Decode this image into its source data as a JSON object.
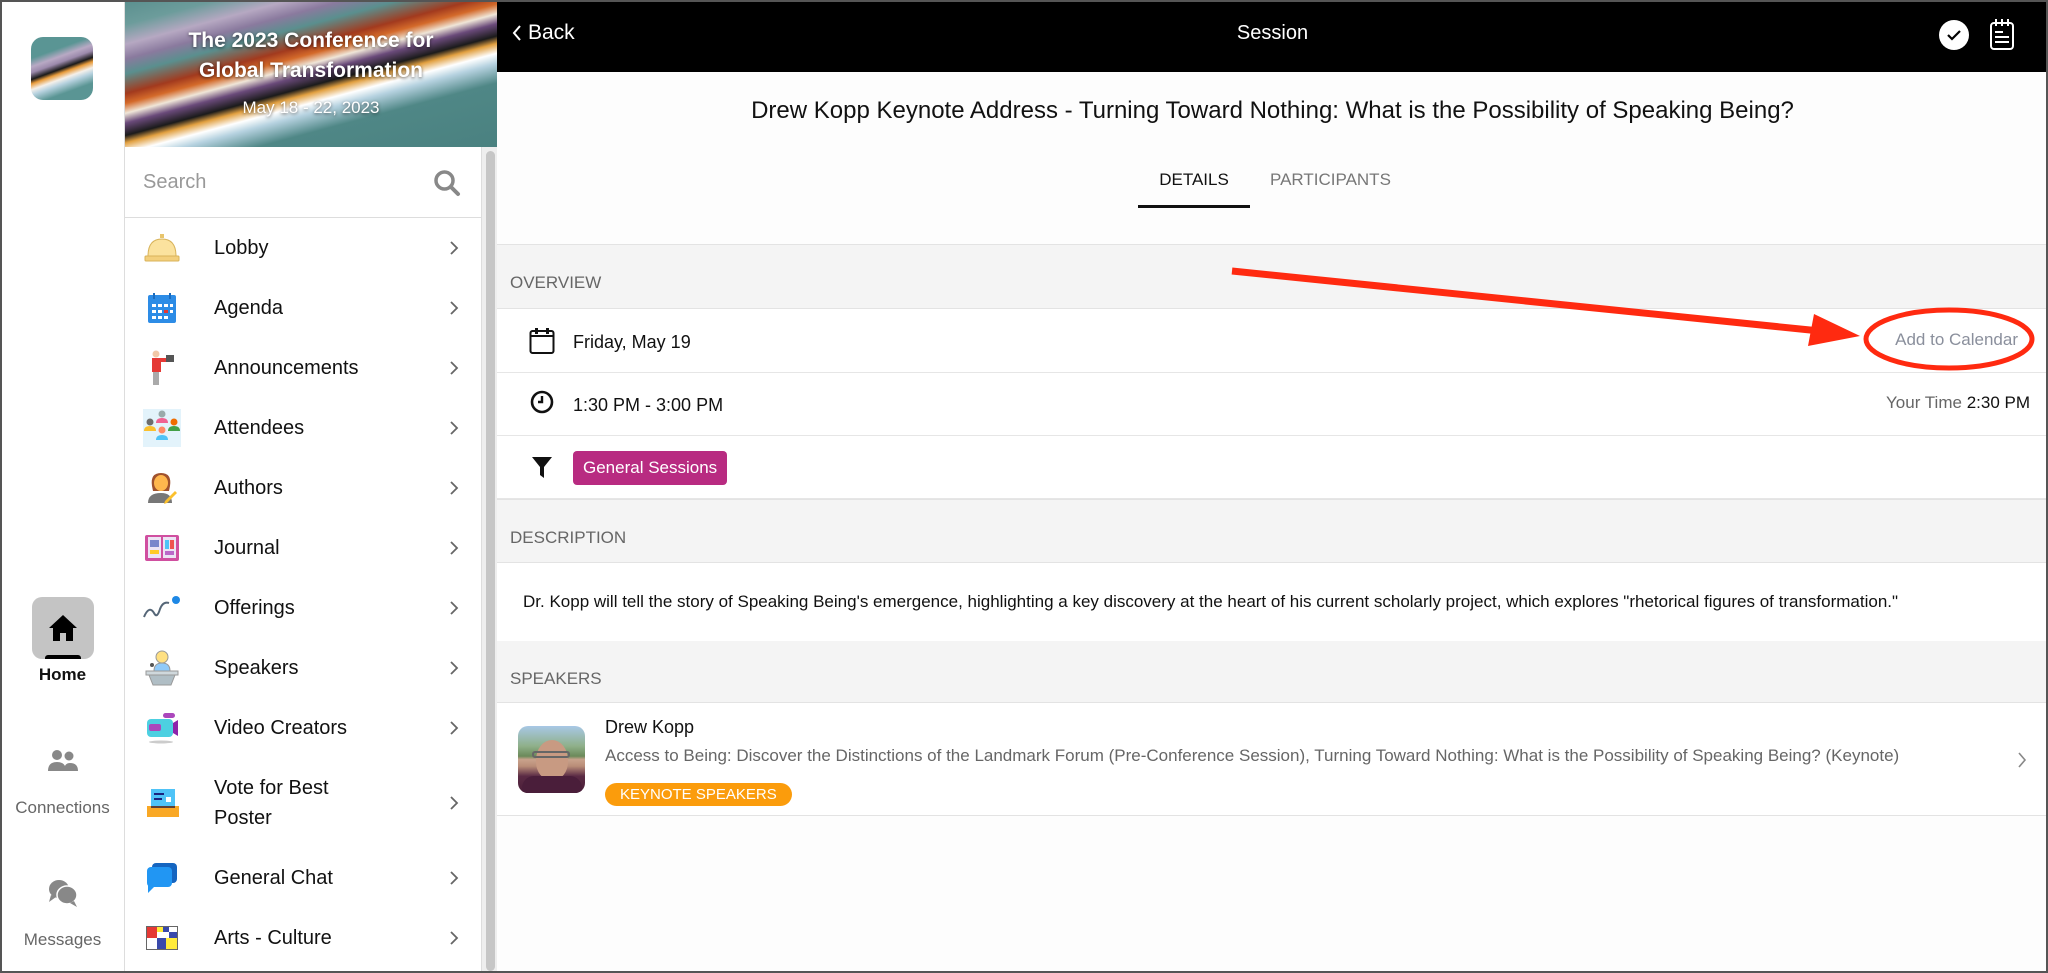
{
  "rail": {
    "items": [
      {
        "label": "Home",
        "icon": "home-icon",
        "active": true
      },
      {
        "label": "Connections",
        "icon": "people-icon",
        "active": false
      },
      {
        "label": "Messages",
        "icon": "chat-bubbles-icon",
        "active": false
      }
    ]
  },
  "sidebar": {
    "banner_title_line1": "The 2023 Conference for",
    "banner_title_line2": "Global Transformation",
    "banner_date": "May 18 - 22, 2023",
    "search_placeholder": "Search",
    "items": [
      {
        "label": "Lobby",
        "icon": "service-bell-icon"
      },
      {
        "label": "Agenda",
        "icon": "calendar-icon"
      },
      {
        "label": "Announcements",
        "icon": "megaphone-person-icon"
      },
      {
        "label": "Attendees",
        "icon": "group-icon"
      },
      {
        "label": "Authors",
        "icon": "author-icon"
      },
      {
        "label": "Journal",
        "icon": "open-book-icon"
      },
      {
        "label": "Offerings",
        "icon": "curve-dot-icon"
      },
      {
        "label": "Speakers",
        "icon": "podium-icon"
      },
      {
        "label": "Video Creators",
        "icon": "video-camera-icon"
      },
      {
        "label": "Vote for Best Poster",
        "icon": "ballot-box-icon"
      },
      {
        "label": "General Chat",
        "icon": "chat-icon"
      },
      {
        "label": "Arts - Culture",
        "icon": "color-grid-icon"
      }
    ]
  },
  "header": {
    "back_label": "Back",
    "title": "Session"
  },
  "session": {
    "title": "Drew Kopp Keynote Address - Turning Toward Nothing: What is the Possibility of Speaking Being?",
    "tabs": [
      {
        "label": "DETAILS",
        "active": true
      },
      {
        "label": "PARTICIPANTS",
        "active": false
      }
    ],
    "overview_label": "OVERVIEW",
    "date": "Friday, May 19",
    "add_to_calendar": "Add to Calendar",
    "time": "1:30 PM - 3:00 PM",
    "your_time_label": "Your Time",
    "your_time_value": "2:30 PM",
    "category": "General Sessions",
    "category_color": "#b82b81",
    "description_label": "DESCRIPTION",
    "description": "Dr. Kopp will tell the story of Speaking Being's emergence, highlighting a key discovery at the heart of his current scholarly project, which explores \"rhetorical figures of transformation.\"",
    "speakers_label": "SPEAKERS",
    "speakers": [
      {
        "name": "Drew Kopp",
        "sessions": "Access to Being: Discover the Distinctions of the Landmark Forum (Pre-Conference Session), Turning Toward Nothing: What is the Possibility of Speaking Being? (Keynote)",
        "badge": "KEYNOTE SPEAKERS",
        "badge_color": "#fb9c0c"
      }
    ]
  },
  "annotation": {
    "color": "#ff2a10",
    "target": "Add to Calendar"
  }
}
